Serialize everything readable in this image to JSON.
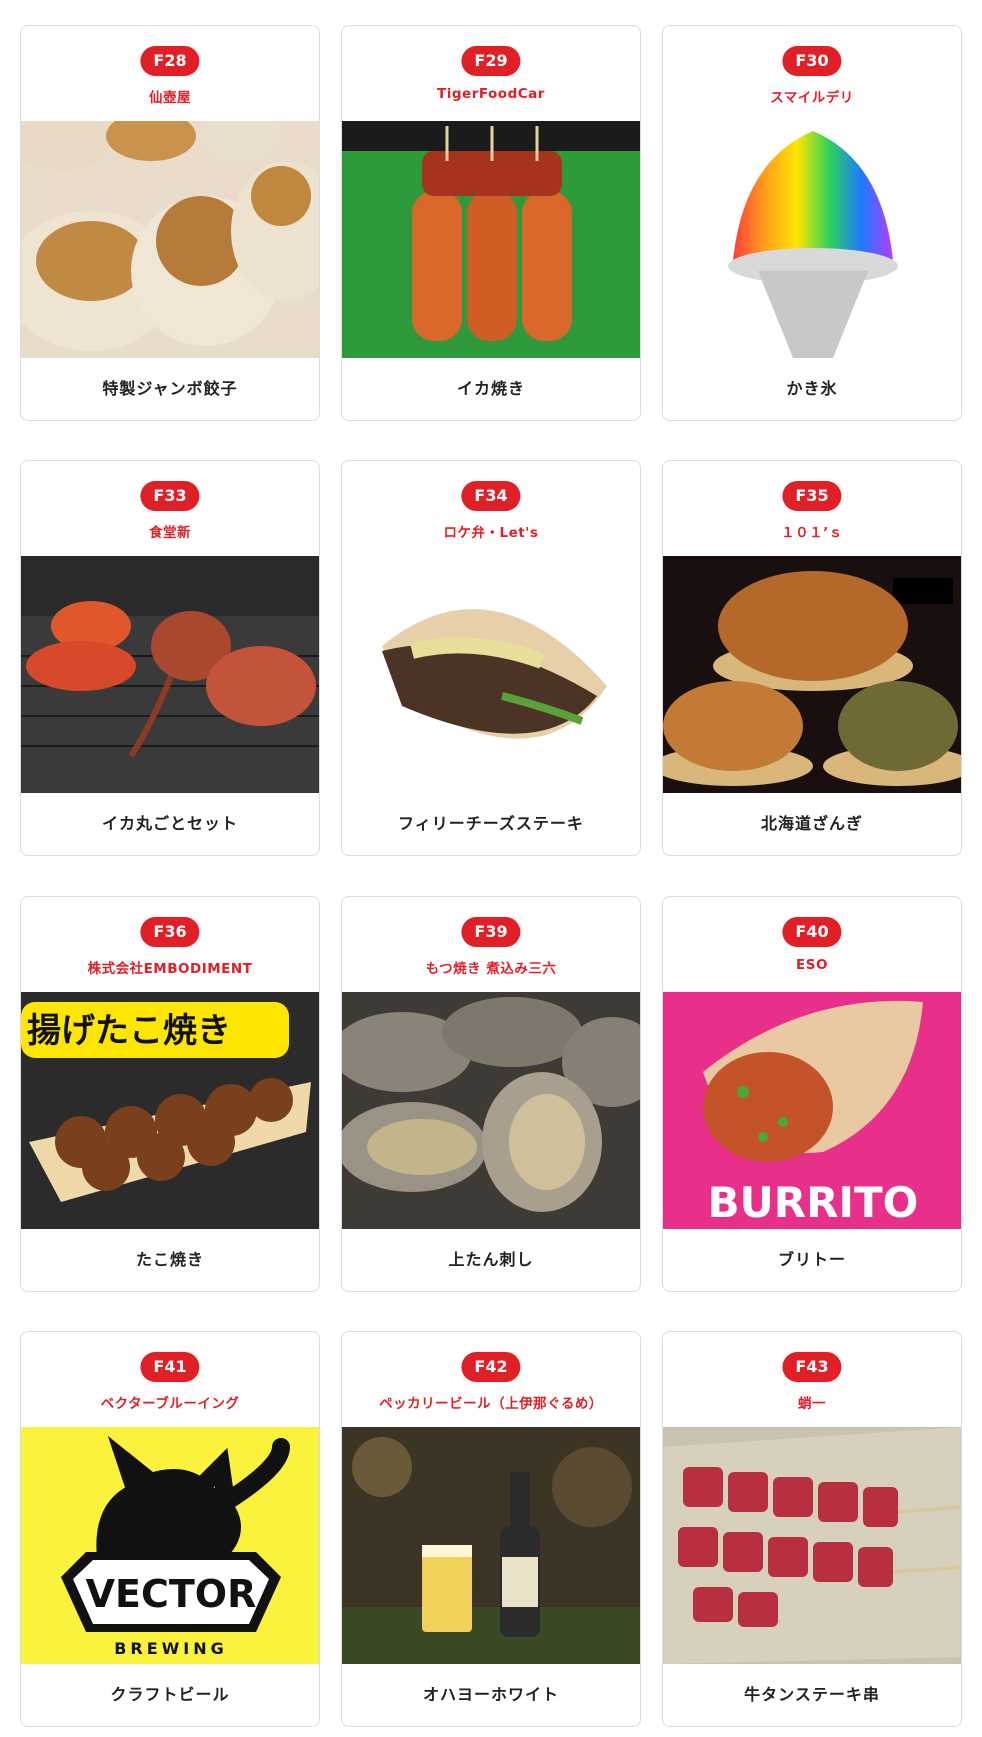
{
  "vendors": [
    {
      "code": "F28",
      "shop": "仙壺屋",
      "item": "特製ジャンボ餃子"
    },
    {
      "code": "F29",
      "shop": "TigerFoodCar",
      "item": "イカ焼き"
    },
    {
      "code": "F30",
      "shop": "スマイルデリ",
      "item": "かき氷"
    },
    {
      "code": "F33",
      "shop": "食堂新",
      "item": "イカ丸ごとセット"
    },
    {
      "code": "F34",
      "shop": "ロケ弁・Let's",
      "item": "フィリーチーズステーキ"
    },
    {
      "code": "F35",
      "shop": "１０１’ｓ",
      "item": "北海道ざんぎ"
    },
    {
      "code": "F36",
      "shop": "株式会社EMBODIMENT",
      "item": "たこ焼き"
    },
    {
      "code": "F39",
      "shop": "もつ焼き 煮込み三六",
      "item": "上たん刺し"
    },
    {
      "code": "F40",
      "shop": "ESO",
      "item": "ブリトー"
    },
    {
      "code": "F41",
      "shop": "ベクターブルーイング",
      "item": "クラフトビール"
    },
    {
      "code": "F42",
      "shop": "ペッカリービール（上伊那ぐるめ）",
      "item": "オハヨーホワイト"
    },
    {
      "code": "F43",
      "shop": "蛸一",
      "item": "牛タンステーキ串"
    }
  ],
  "photo_text": {
    "takoyaki_banner": "揚げたこ焼き",
    "burrito_logo": "BURRITO",
    "vector_logo": "VECTOR",
    "vector_sub": "BREWING"
  },
  "colors": {
    "accent": "#e11f26",
    "text": "#222222",
    "border": "#dcdcdc"
  }
}
